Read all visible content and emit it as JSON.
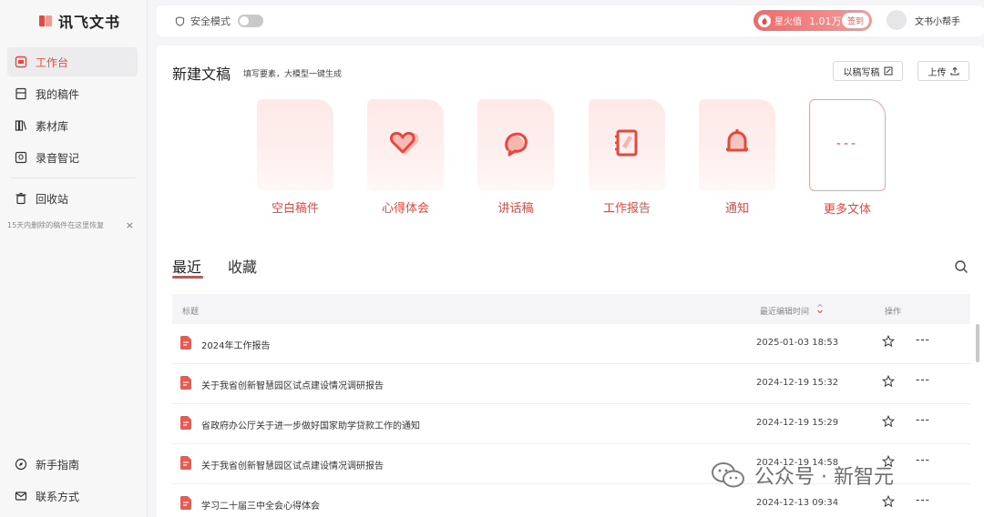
{
  "app": {
    "name": "讯飞文书"
  },
  "sidebar": {
    "items": [
      {
        "label": "工作台",
        "icon": "workspace-icon",
        "active": true
      },
      {
        "label": "我的稿件",
        "icon": "drafts-icon"
      },
      {
        "label": "素材库",
        "icon": "library-icon"
      },
      {
        "label": "录音智记",
        "icon": "recording-icon"
      }
    ],
    "recycle": {
      "label": "回收站",
      "tip": "15天内删除的稿件在这里恢复",
      "close": "×"
    },
    "bottom": [
      {
        "label": "新手指南",
        "icon": "compass-icon"
      },
      {
        "label": "联系方式",
        "icon": "mail-icon"
      }
    ]
  },
  "topbar": {
    "safe_mode_label": "安全模式",
    "safe_mode_on": false,
    "spark": {
      "label": "星火值",
      "value": "1.01万",
      "checkin": "签到"
    },
    "user_name": "文书小帮手"
  },
  "new_doc": {
    "title": "新建文稿",
    "subtitle": "填写要素，大模型一键生成",
    "write_by_draft": "以稿写稿",
    "upload": "上传",
    "cards": [
      {
        "label": "空白稿件",
        "icon": "blank-doc-icon"
      },
      {
        "label": "心得体会",
        "icon": "heart-icon"
      },
      {
        "label": "讲话稿",
        "icon": "speech-bubble-icon"
      },
      {
        "label": "工作报告",
        "icon": "notebook-icon"
      },
      {
        "label": "通知",
        "icon": "bell-icon"
      },
      {
        "label": "更多文体",
        "icon": "dots-icon",
        "dots": "---"
      }
    ]
  },
  "tabs": [
    {
      "label": "最近",
      "active": true
    },
    {
      "label": "收藏",
      "active": false
    }
  ],
  "table": {
    "headers": {
      "title": "标题",
      "time": "最近编辑时间",
      "ops": "操作"
    },
    "rows": [
      {
        "title": "2024年工作报告",
        "time": "2025-01-03 18:53"
      },
      {
        "title": "关于我省创新智慧园区试点建设情况调研报告",
        "time": "2024-12-19 15:32"
      },
      {
        "title": "省政府办公厅关于进一步做好国家助学贷款工作的通知",
        "time": "2024-12-19 15:29"
      },
      {
        "title": "关于我省创新智慧园区试点建设情况调研报告",
        "time": "2024-12-19 14:58"
      },
      {
        "title": "学习二十届三中全会心得体会",
        "time": "2024-12-13 09:34"
      }
    ],
    "more_glyph": "---"
  },
  "watermark": "公众号 · 新智元",
  "colors": {
    "accent": "#e8463f",
    "card_bg": "#fde9e7",
    "sidebar_bg": "#f7f7f8"
  }
}
